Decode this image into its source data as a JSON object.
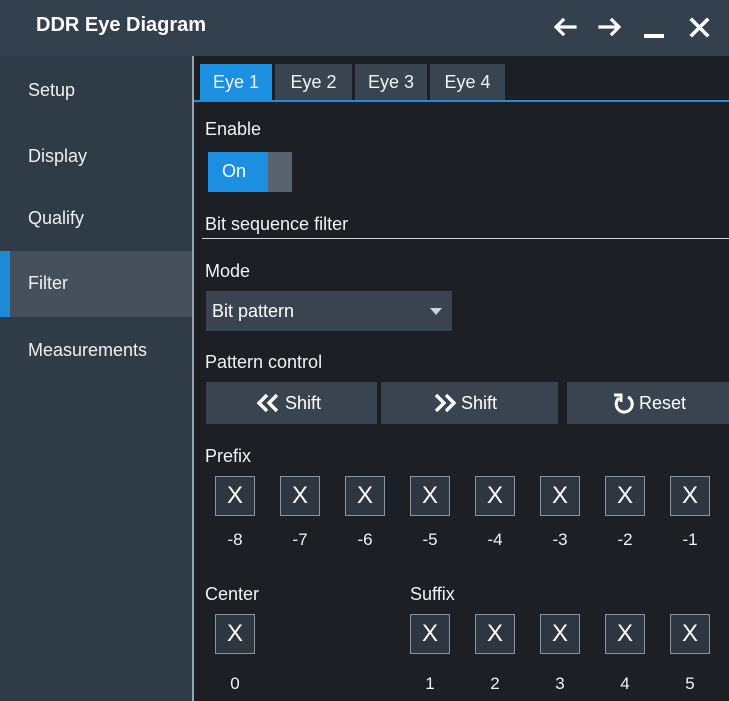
{
  "window": {
    "title": "DDR Eye Diagram",
    "controls": [
      "arrow-left-icon",
      "arrow-right-icon",
      "minimize-icon",
      "close-icon"
    ]
  },
  "sidebar": {
    "items": [
      {
        "label": "Setup"
      },
      {
        "label": "Display"
      },
      {
        "label": "Qualify"
      },
      {
        "label": "Filter"
      },
      {
        "label": "Measurements"
      }
    ],
    "active": "Filter"
  },
  "tabs": [
    {
      "label": "Eye 1"
    },
    {
      "label": "Eye 2"
    },
    {
      "label": "Eye 3"
    },
    {
      "label": "Eye 4"
    }
  ],
  "active_tab": "Eye 1",
  "enable": {
    "label": "Enable",
    "state": "On"
  },
  "filter": {
    "section_title": "Bit sequence filter",
    "mode_label": "Mode",
    "mode_value": "Bit pattern",
    "pattern_control_label": "Pattern control",
    "shift_left_label": "Shift",
    "shift_right_label": "Shift",
    "reset_label": "Reset"
  },
  "prefix": {
    "label": "Prefix",
    "bits": [
      {
        "value": "X",
        "index": "-8"
      },
      {
        "value": "X",
        "index": "-7"
      },
      {
        "value": "X",
        "index": "-6"
      },
      {
        "value": "X",
        "index": "-5"
      },
      {
        "value": "X",
        "index": "-4"
      },
      {
        "value": "X",
        "index": "-3"
      },
      {
        "value": "X",
        "index": "-2"
      },
      {
        "value": "X",
        "index": "-1"
      }
    ]
  },
  "center": {
    "label": "Center",
    "bit": {
      "value": "X",
      "index": "0"
    }
  },
  "suffix": {
    "label": "Suffix",
    "bits": [
      {
        "value": "X",
        "index": "1"
      },
      {
        "value": "X",
        "index": "2"
      },
      {
        "value": "X",
        "index": "3"
      },
      {
        "value": "X",
        "index": "4"
      },
      {
        "value": "X",
        "index": "5"
      }
    ]
  },
  "colors": {
    "accent": "#1d8fe0",
    "titlebar": "#33404d",
    "sidebar": "#2f3b47",
    "background": "#1c1f23",
    "control": "#3a4450"
  }
}
